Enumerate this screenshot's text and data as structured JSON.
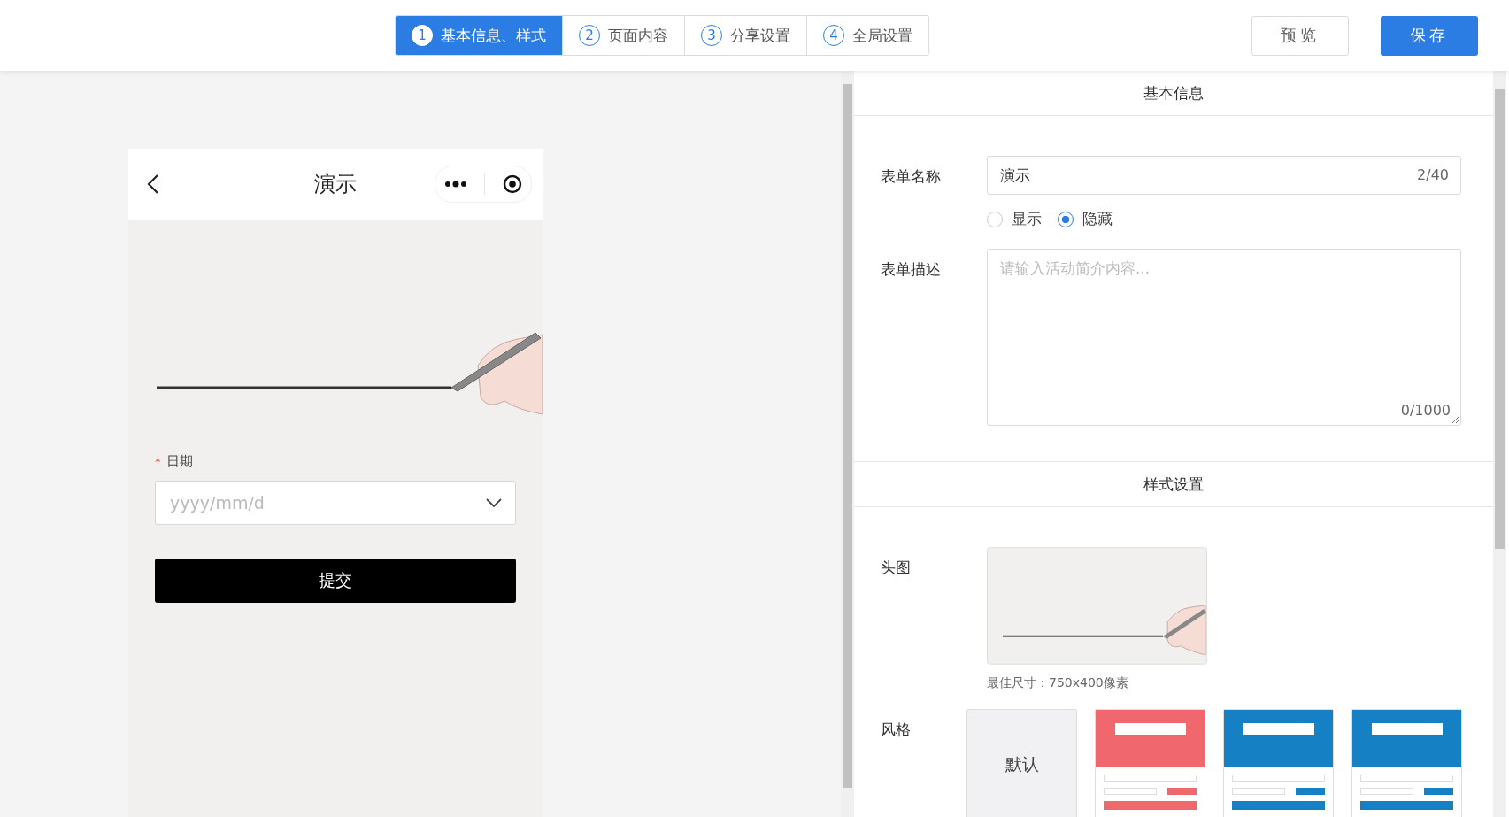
{
  "steps": [
    {
      "number": "1",
      "label": "基本信息、样式",
      "selected": true
    },
    {
      "number": "2",
      "label": "页面内容",
      "selected": false
    },
    {
      "number": "3",
      "label": "分享设置",
      "selected": false
    },
    {
      "number": "4",
      "label": "全局设置",
      "selected": false
    }
  ],
  "actions": {
    "preview": "预览",
    "save": "保存"
  },
  "phone": {
    "title": "演示",
    "field_label": "日期",
    "required_mark": "*",
    "date_placeholder": "yyyy/mm/d",
    "submit": "提交"
  },
  "basic_info": {
    "heading": "基本信息",
    "name_label": "表单名称",
    "name_value": "演示",
    "name_count": "2/40",
    "visibility": [
      {
        "label": "显示",
        "selected": false
      },
      {
        "label": "隐藏",
        "selected": true
      }
    ],
    "desc_label": "表单描述",
    "desc_placeholder": "请输入活动简介内容...",
    "desc_count": "0/1000"
  },
  "style_settings": {
    "heading": "样式设置",
    "image_label": "头图",
    "image_hint": "最佳尺寸：750x400像素",
    "style_label": "风格",
    "styles": [
      {
        "kind": "plain",
        "label": "默认"
      },
      {
        "kind": "theme",
        "color": "#f0686e"
      },
      {
        "kind": "theme",
        "color": "#1580c4"
      },
      {
        "kind": "theme",
        "color": "#1580c4"
      }
    ]
  }
}
